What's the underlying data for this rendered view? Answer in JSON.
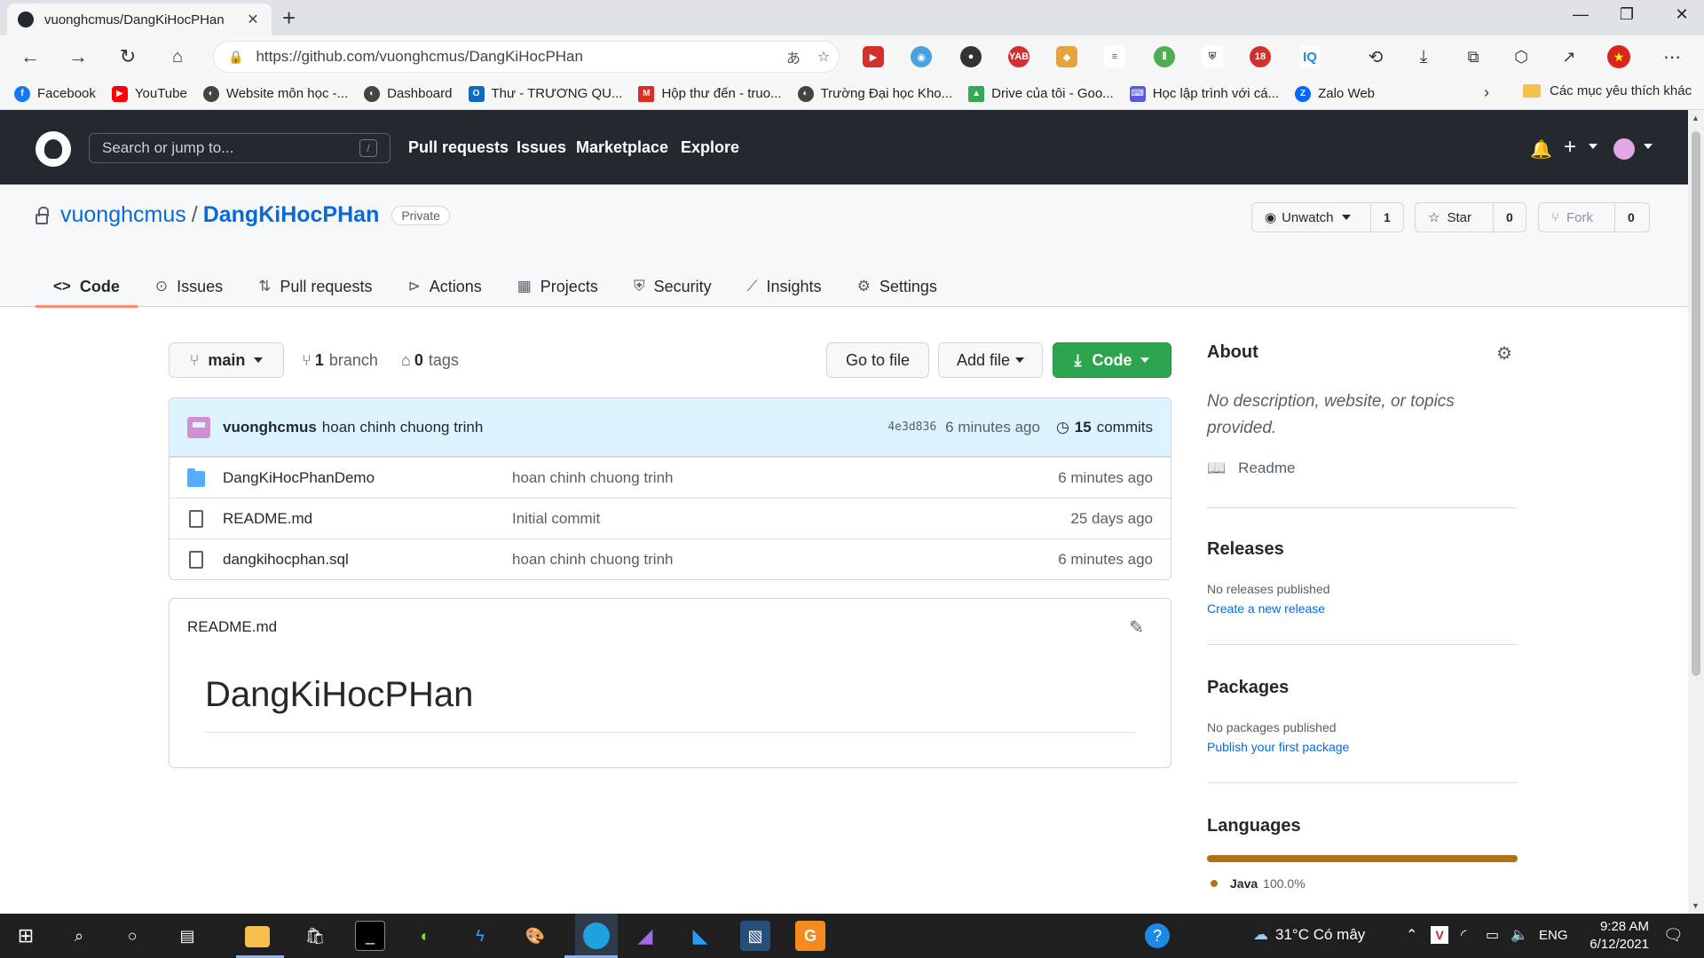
{
  "browser": {
    "tab_title": "vuonghcmus/DangKiHocPHan",
    "url": "https://github.com/vuonghcmus/DangKiHocPHan",
    "bookmarks": [
      {
        "label": "Facebook",
        "color": "#1877f2"
      },
      {
        "label": "YouTube",
        "color": "#ff0000"
      },
      {
        "label": "Website môn học -...",
        "color": "#444444"
      },
      {
        "label": "Dashboard",
        "color": "#444444"
      },
      {
        "label": "Thư - TRƯƠNG QU...",
        "color": "#0f6cbd"
      },
      {
        "label": "Hộp thư đến - truo...",
        "color": "#d93025"
      },
      {
        "label": "Trường Đại học Kho...",
        "color": "#444444"
      },
      {
        "label": "Drive của tôi - Goo...",
        "color": "#34a853"
      },
      {
        "label": "Học lập trình với cá...",
        "color": "#5b5bd6"
      },
      {
        "label": "Zalo Web",
        "color": "#0068ff"
      }
    ],
    "bookmarks_more_folder": "Các mục yêu thích khác"
  },
  "github": {
    "search_placeholder": "Search or jump to...",
    "search_key": "/",
    "nav": [
      "Pull requests",
      "Issues",
      "Marketplace",
      "Explore"
    ]
  },
  "repo": {
    "owner": "vuonghcmus",
    "separator": "/",
    "name": "DangKiHocPHan",
    "visibility": "Private",
    "watch": {
      "label": "Unwatch",
      "count": "1"
    },
    "star": {
      "label": "Star",
      "count": "0"
    },
    "fork": {
      "label": "Fork",
      "count": "0"
    },
    "tabs": [
      "Code",
      "Issues",
      "Pull requests",
      "Actions",
      "Projects",
      "Security",
      "Insights",
      "Settings"
    ],
    "branch": "main",
    "branches_count": "1",
    "branches_label": "branch",
    "tags_count": "0",
    "tags_label": "tags",
    "go_to_file": "Go to file",
    "add_file": "Add file",
    "code_button": "Code",
    "latest_commit": {
      "author": "vuonghcmus",
      "message": "hoan chinh chuong trinh",
      "sha": "4e3d836",
      "time": "6 minutes ago",
      "commits_count": "15",
      "commits_label": "commits"
    },
    "files": [
      {
        "type": "dir",
        "name": "DangKiHocPhanDemo",
        "message": "hoan chinh chuong trinh",
        "age": "6 minutes ago"
      },
      {
        "type": "file",
        "name": "README.md",
        "message": "Initial commit",
        "age": "25 days ago"
      },
      {
        "type": "file",
        "name": "dangkihocphan.sql",
        "message": "hoan chinh chuong trinh",
        "age": "6 minutes ago"
      }
    ],
    "readme": {
      "filename": "README.md",
      "heading": "DangKiHocPHan"
    }
  },
  "sidebar": {
    "about_title": "About",
    "about_text": "No description, website, or topics provided.",
    "readme_link": "Readme",
    "releases_title": "Releases",
    "releases_text": "No releases published",
    "releases_link": "Create a new release",
    "packages_title": "Packages",
    "packages_text": "No packages published",
    "packages_link": "Publish your first package",
    "languages_title": "Languages",
    "language": {
      "name": "Java",
      "percent": "100.0%",
      "share": 1.0,
      "color": "#b07219"
    }
  },
  "taskbar": {
    "weather": "31°C Có mây",
    "lang": "ENG",
    "time": "9:28 AM",
    "date": "6/12/2021"
  }
}
